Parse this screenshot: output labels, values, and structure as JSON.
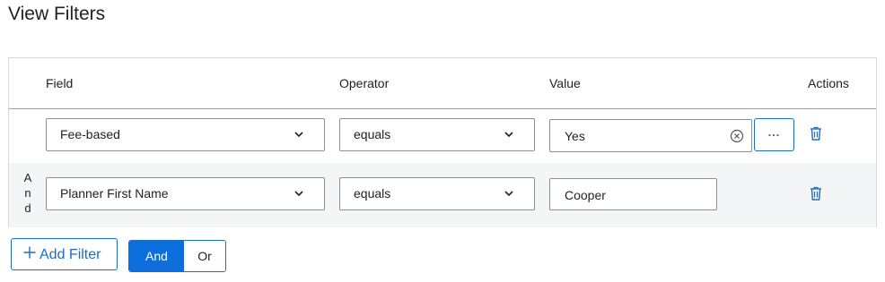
{
  "page": {
    "title": "View Filters"
  },
  "table": {
    "headers": {
      "field": "Field",
      "operator": "Operator",
      "value": "Value",
      "actions": "Actions"
    },
    "rows": [
      {
        "conjunction": "",
        "field": "Fee-based",
        "operator": "equals",
        "value": "Yes",
        "has_clear": true,
        "has_lookup": true,
        "lookup_label": "..."
      },
      {
        "conjunction": "And",
        "field": "Planner First Name",
        "operator": "equals",
        "value": "Cooper",
        "has_clear": false,
        "has_lookup": false
      }
    ]
  },
  "footer": {
    "add_filter_label": "Add Filter",
    "logic_options": [
      "And",
      "Or"
    ],
    "logic_selected": "And"
  },
  "colors": {
    "accent": "#1b6ec2",
    "selected_bg": "#0d6fde",
    "row_alt_bg": "#f4f5f6",
    "border": "#8a8f94"
  },
  "icons": {
    "dropdown": "chevron-down-icon",
    "clear": "clear-circle-icon",
    "delete": "trash-icon",
    "add": "plus-icon"
  }
}
